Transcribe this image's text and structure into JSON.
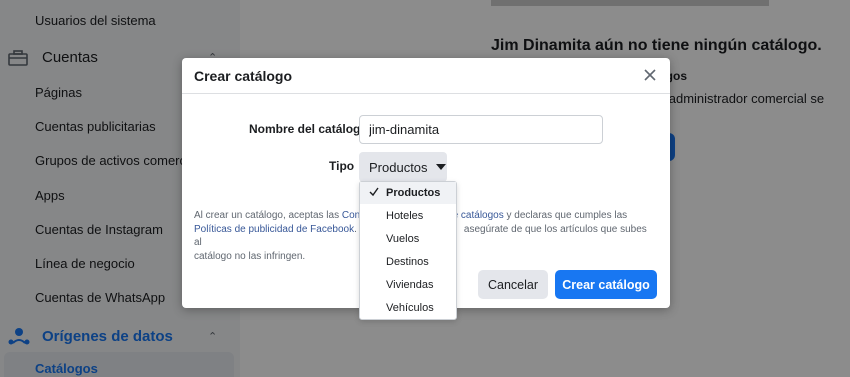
{
  "sidebar": {
    "items_top": [
      "Usuarios del sistema"
    ],
    "group_accounts": "Cuentas",
    "accounts_items": [
      "Páginas",
      "Cuentas publicitarias",
      "Grupos de activos comerciales",
      "Apps",
      "Cuentas de Instagram",
      "Línea de negocio",
      "Cuentas de WhatsApp"
    ],
    "group_data": "Orígenes de datos",
    "data_items": [
      "Catálogos"
    ]
  },
  "main": {
    "empty_title": "Jim Dinamita aún no tiene ningún catálogo.",
    "empty_subtitle": "logos",
    "empty_text": "al administrador comercial se"
  },
  "modal": {
    "title": "Crear catálogo",
    "name_label": "Nombre del catálogo",
    "name_value": "jim-dinamita",
    "type_label": "Tipo",
    "type_value": "Productos",
    "terms_1": "Al crear un catálogo, aceptas las ",
    "terms_link_1": "Cond",
    "terms_link_1b": "dor de catálogos",
    "terms_2": " y declaras que cumples las",
    "terms_link_2": "Políticas de publicidad de Facebook",
    "terms_3": ". R",
    "terms_4": "asegúrate de que los artículos que subes al",
    "terms_5": "catálogo no las infringen.",
    "cancel_label": "Cancelar",
    "create_label": "Crear catálogo"
  },
  "dropdown": {
    "options": [
      "Productos",
      "Hoteles",
      "Vuelos",
      "Destinos",
      "Viviendas",
      "Vehículos"
    ],
    "selected_index": 0
  },
  "colors": {
    "primary": "#1877f2",
    "link": "#385898"
  }
}
